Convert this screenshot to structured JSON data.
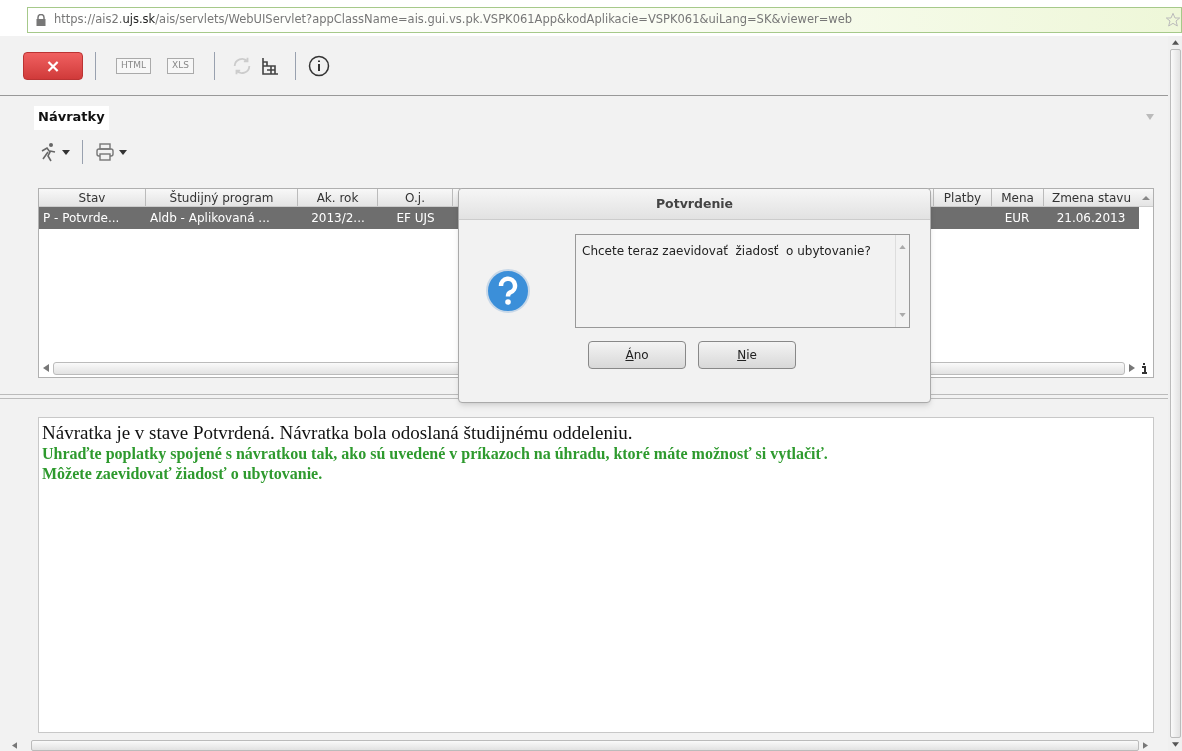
{
  "address_bar": {
    "url": "https://ais2.**ujs.sk**/ais/servlets/WebUIServlet?appClassName=ais.gui.vs.pk.VSPK061App&kodAplikacie=VSPK061&uiLang=SK&viewer=web"
  },
  "toolbar": [
    {
      "kind": "close",
      "label": "×",
      "disabled": false
    },
    {
      "kind": "separator"
    },
    {
      "kind": "export",
      "label": "HTML",
      "disabled": true
    },
    {
      "kind": "export",
      "label": "XLS",
      "disabled": true
    },
    {
      "kind": "separator"
    },
    {
      "kind": "refresh",
      "disabled": true
    },
    {
      "kind": "grid",
      "disabled": false
    },
    {
      "kind": "separator"
    },
    {
      "kind": "info",
      "disabled": false
    }
  ],
  "panel": {
    "title": "Návratky"
  },
  "table": {
    "columns": [
      "Stav",
      "Študijný program",
      "Ak. rok",
      "O.j.",
      "Platby",
      "Mena",
      "Zmena stavu"
    ],
    "rows": [
      {
        "selected": true,
        "cells": [
          "P - Potvrde...",
          "Aldb - Aplikovaná ...",
          "2013/2...",
          "EF UJS",
          "",
          "EUR",
          "21.06.2013"
        ]
      }
    ]
  },
  "messages": [
    {
      "kind": "plain",
      "text": "Návratka je v stave Potvrdená. Návratka bola odoslaná študijnému oddeleniu."
    },
    {
      "kind": "highlight",
      "text": "Uhraďte poplatky spojené s návratkou tak, ako sú uvedené v príkazoch na úhradu, ktoré máte možnosť si vytlačiť."
    },
    {
      "kind": "highlight",
      "text": "Môžete zaevidovať žiadosť o ubytovanie."
    }
  ],
  "dialog": {
    "title": "Potvrdenie",
    "message": "Chcete teraz zaevidovať  žiadosť  o ubytovanie?",
    "buttons": [
      "Áno",
      "Nie"
    ]
  }
}
